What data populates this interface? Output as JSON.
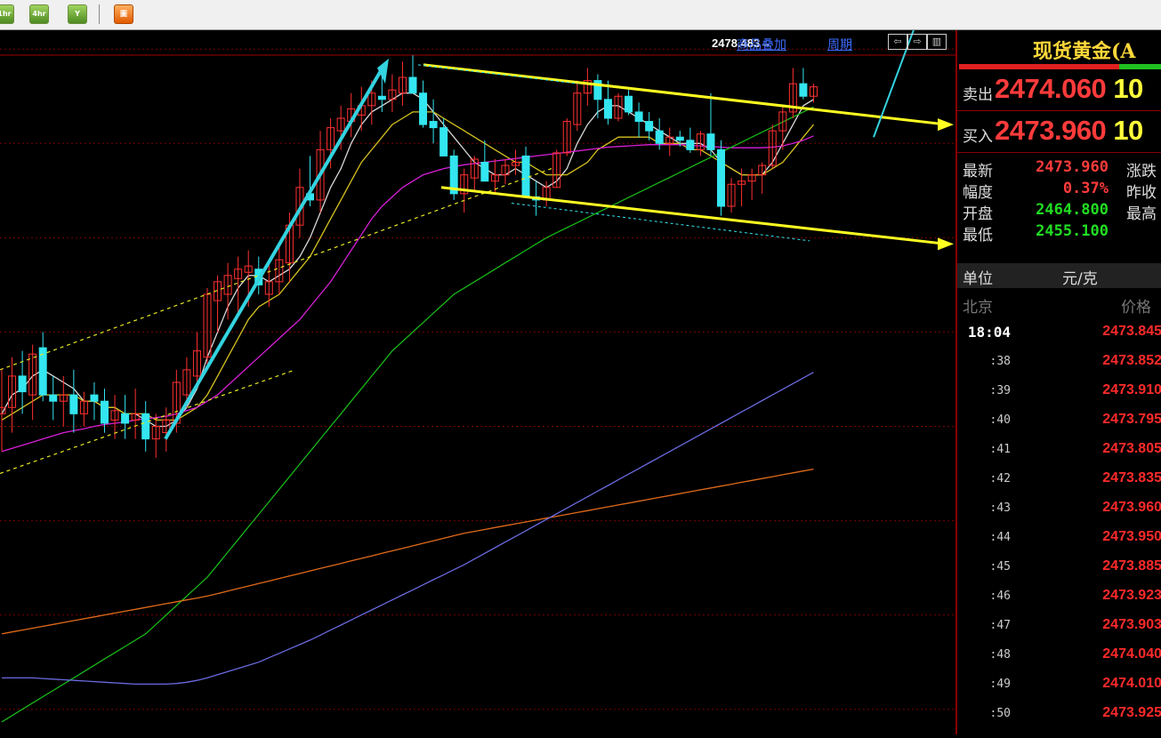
{
  "toolbar": {
    "buttons": [
      {
        "label": "1hr",
        "icon": "hour-chart-icon"
      },
      {
        "label": "4hr",
        "icon": "four-hour-chart-icon"
      },
      {
        "label": "Y",
        "icon": "year-chart-icon"
      },
      {
        "label": "圖",
        "icon": "grid-window-icon"
      }
    ]
  },
  "chart_header": {
    "overlay_label": "商品叠加",
    "period_label": "周期"
  },
  "chart_data": {
    "type": "candlestick",
    "title": "",
    "price_annotation": "2478.483→",
    "ylim": [
      2380,
      2492
    ],
    "candles": [
      [
        2431.0,
        2438.0,
        2425.0,
        2432.0
      ],
      [
        2432.0,
        2440.0,
        2428.0,
        2437.0
      ],
      [
        2437.0,
        2441.0,
        2431.0,
        2434.5
      ],
      [
        2434.0,
        2442.0,
        2430.0,
        2440.5
      ],
      [
        2441.5,
        2444.0,
        2433.0,
        2434.0
      ],
      [
        2434.0,
        2437.0,
        2430.0,
        2433.0
      ],
      [
        2433.0,
        2437.0,
        2429.0,
        2434.0
      ],
      [
        2434.0,
        2438.0,
        2428.0,
        2431.0
      ],
      [
        2431.0,
        2434.5,
        2429.0,
        2433.0
      ],
      [
        2434.0,
        2436.0,
        2430.0,
        2433.0
      ],
      [
        2433.0,
        2435.0,
        2428.0,
        2429.5
      ],
      [
        2430.0,
        2434.0,
        2427.0,
        2431.5
      ],
      [
        2431.0,
        2434.0,
        2427.0,
        2429.5
      ],
      [
        2430.0,
        2435.0,
        2427.0,
        2431.0
      ],
      [
        2431.0,
        2433.0,
        2425.0,
        2427.0
      ],
      [
        2427.0,
        2431.0,
        2424.0,
        2429.0
      ],
      [
        2428.0,
        2432.0,
        2425.0,
        2430.0
      ],
      [
        2429.5,
        2438.0,
        2428.0,
        2436.0
      ],
      [
        2434.0,
        2440.0,
        2432.0,
        2438.0
      ],
      [
        2437.0,
        2444.0,
        2435.0,
        2441.0
      ],
      [
        2440.0,
        2451.0,
        2438.0,
        2450.0
      ],
      [
        2449.0,
        2453.0,
        2444.0,
        2452.0
      ],
      [
        2450.0,
        2455.0,
        2446.0,
        2453.0
      ],
      [
        2452.5,
        2456.0,
        2447.0,
        2454.0
      ],
      [
        2453.5,
        2457.0,
        2448.0,
        2454.5
      ],
      [
        2454.0,
        2456.0,
        2450.0,
        2451.5
      ],
      [
        2450.0,
        2455.0,
        2448.0,
        2452.0
      ],
      [
        2452.0,
        2458.0,
        2450.0,
        2455.5
      ],
      [
        2455.0,
        2463.0,
        2452.0,
        2461.0
      ],
      [
        2461.0,
        2470.0,
        2459.0,
        2467.0
      ],
      [
        2466.0,
        2472.0,
        2464.0,
        2465.0
      ],
      [
        2465.0,
        2476.0,
        2463.0,
        2473.0
      ],
      [
        2473.0,
        2478.0,
        2470.0,
        2476.5
      ],
      [
        2476.0,
        2480.0,
        2473.0,
        2478.0
      ],
      [
        2477.5,
        2482.0,
        2475.0,
        2479.5
      ],
      [
        2478.5,
        2483.0,
        2476.0,
        2480.0
      ],
      [
        2480.0,
        2484.0,
        2477.0,
        2482.0
      ],
      [
        2481.5,
        2485.0,
        2479.0,
        2481.0
      ],
      [
        2481.0,
        2485.0,
        2479.0,
        2482.5
      ],
      [
        2482.0,
        2487.0,
        2480.0,
        2484.5
      ],
      [
        2484.5,
        2488.0,
        2482.0,
        2482.0
      ],
      [
        2482.0,
        2484.0,
        2476.5,
        2477.0
      ],
      [
        2477.5,
        2481.0,
        2474.0,
        2476.5
      ],
      [
        2476.5,
        2478.0,
        2472.5,
        2472.0
      ],
      [
        2472.0,
        2473.0,
        2465.0,
        2466.0
      ],
      [
        2466.0,
        2470.0,
        2463.0,
        2469.0
      ],
      [
        2468.5,
        2472.0,
        2466.5,
        2471.5
      ],
      [
        2471.0,
        2474.5,
        2469.5,
        2468.0
      ],
      [
        2468.0,
        2471.5,
        2466.0,
        2469.0
      ],
      [
        2469.0,
        2471.5,
        2467.5,
        2470.5
      ],
      [
        2470.5,
        2473.0,
        2469.0,
        2471.0
      ],
      [
        2472.0,
        2473.5,
        2466.5,
        2465.5
      ],
      [
        2465.5,
        2468.0,
        2462.5,
        2465.0
      ],
      [
        2465.0,
        2468.0,
        2464.0,
        2467.0
      ],
      [
        2467.0,
        2473.0,
        2467.0,
        2472.5
      ],
      [
        2472.5,
        2478.0,
        2472.0,
        2477.5
      ],
      [
        2477.0,
        2484.0,
        2476.0,
        2482.0
      ],
      [
        2482.0,
        2486.0,
        2480.0,
        2484.0
      ],
      [
        2484.0,
        2485.0,
        2478.0,
        2481.0
      ],
      [
        2481.0,
        2484.0,
        2477.0,
        2478.0
      ],
      [
        2478.0,
        2482.0,
        2477.5,
        2481.5
      ],
      [
        2481.5,
        2482.5,
        2478.5,
        2479.0
      ],
      [
        2479.0,
        2480.5,
        2475.0,
        2477.5
      ],
      [
        2477.5,
        2479.0,
        2474.5,
        2476.0
      ],
      [
        2476.0,
        2478.0,
        2473.0,
        2474.0
      ],
      [
        2474.0,
        2476.5,
        2472.0,
        2475.0
      ],
      [
        2475.0,
        2476.0,
        2473.5,
        2474.5
      ],
      [
        2474.5,
        2476.5,
        2472.5,
        2473.0
      ],
      [
        2473.0,
        2476.0,
        2472.0,
        2475.5
      ],
      [
        2475.5,
        2482.0,
        2472.0,
        2473.0
      ],
      [
        2473.0,
        2474.5,
        2462.5,
        2464.0
      ],
      [
        2464.0,
        2468.5,
        2463.0,
        2467.5
      ],
      [
        2467.5,
        2470.0,
        2464.0,
        2468.0
      ],
      [
        2468.0,
        2470.0,
        2465.0,
        2469.0
      ],
      [
        2469.0,
        2471.0,
        2466.0,
        2470.5
      ],
      [
        2470.5,
        2477.0,
        2470.0,
        2476.0
      ],
      [
        2476.0,
        2480.0,
        2473.0,
        2479.0
      ],
      [
        2479.0,
        2486.0,
        2478.0,
        2483.5
      ],
      [
        2483.5,
        2486.0,
        2481.0,
        2481.5
      ],
      [
        2481.5,
        2483.5,
        2480.5,
        2483.0
      ]
    ],
    "moving_averages": [
      {
        "color": "#d9d9d9",
        "values": [
          2431,
          2434,
          2435,
          2437,
          2438,
          2437,
          2436,
          2435,
          2433,
          2433,
          2432,
          2432,
          2431,
          2431,
          2430,
          2429,
          2429,
          2430,
          2432,
          2435,
          2440,
          2444,
          2448,
          2451,
          2453,
          2453,
          2452,
          2453,
          2454,
          2456,
          2459,
          2463,
          2467,
          2470,
          2474,
          2477,
          2479,
          2480,
          2481,
          2482,
          2482,
          2481,
          2479,
          2477,
          2475,
          2473,
          2471,
          2470,
          2469,
          2469,
          2470,
          2469,
          2468,
          2467,
          2468,
          2470,
          2474,
          2477,
          2479,
          2480,
          2480,
          2479,
          2478,
          2477,
          2476,
          2475,
          2474,
          2474,
          2474,
          2473,
          2471,
          2470,
          2469,
          2469,
          2469,
          2471,
          2474,
          2477,
          2480,
          2481
        ]
      },
      {
        "color": "#d6c21f",
        "values": [
          2430,
          2431,
          2432,
          2433,
          2434,
          2434,
          2434,
          2434,
          2433,
          2433,
          2432,
          2432,
          2431,
          2431,
          2431,
          2430,
          2430,
          2430,
          2431,
          2432,
          2434,
          2437,
          2440,
          2443,
          2446,
          2448,
          2449,
          2450,
          2452,
          2454,
          2456,
          2459,
          2462,
          2465,
          2468,
          2471,
          2473,
          2475,
          2477,
          2478,
          2479,
          2479,
          2479,
          2478,
          2477,
          2476,
          2475,
          2474,
          2473,
          2472,
          2471,
          2471,
          2470,
          2469,
          2469,
          2469,
          2470,
          2471,
          2473,
          2474,
          2475,
          2475,
          2475,
          2475,
          2474,
          2474,
          2474,
          2473,
          2473,
          2472,
          2471,
          2470,
          2469,
          2469,
          2469,
          2470,
          2471,
          2473,
          2475,
          2477
        ]
      },
      {
        "color": "#d81fd8",
        "values": [
          2425,
          2425.5,
          2426,
          2426.5,
          2427,
          2427.5,
          2428,
          2428.3,
          2428.6,
          2429,
          2429.3,
          2429.5,
          2429.7,
          2430,
          2430.2,
          2430.4,
          2430.6,
          2431,
          2431.5,
          2432,
          2433,
          2434,
          2435.5,
          2437,
          2438.5,
          2440,
          2441.5,
          2443,
          2444.5,
          2446,
          2448,
          2450,
          2452,
          2454.5,
          2457,
          2459.5,
          2462,
          2464,
          2465.5,
          2467,
          2468,
          2469,
          2469.5,
          2470,
          2470.3,
          2470.6,
          2470.8,
          2471,
          2471.2,
          2471.4,
          2471.6,
          2471.8,
          2472,
          2472.2,
          2472.4,
          2472.6,
          2472.8,
          2473,
          2473.2,
          2473.4,
          2473.5,
          2473.6,
          2473.7,
          2473.8,
          2473.8,
          2473.8,
          2473.8,
          2473.7,
          2473.6,
          2473.5,
          2473.4,
          2473.3,
          2473.3,
          2473.3,
          2473.3,
          2473.4,
          2473.6,
          2474,
          2474.5,
          2475.2
        ]
      },
      {
        "color": "#18b818",
        "values": [
          2382,
          2383,
          2384,
          2385,
          2386,
          2387,
          2388,
          2389,
          2390,
          2391,
          2392,
          2393,
          2394,
          2395,
          2396,
          2397.5,
          2399,
          2400.5,
          2402,
          2403.5,
          2405,
          2407,
          2409,
          2411,
          2413,
          2415,
          2417,
          2419,
          2421,
          2423,
          2425,
          2427,
          2429,
          2431,
          2433,
          2435,
          2437,
          2439,
          2441,
          2442.5,
          2444,
          2445.5,
          2447,
          2448.5,
          2450,
          2451,
          2452,
          2453,
          2454,
          2455,
          2456,
          2457,
          2458,
          2459,
          2459.8,
          2460.6,
          2461.4,
          2462.2,
          2463,
          2463.8,
          2464.6,
          2465.4,
          2466.2,
          2467,
          2467.8,
          2468.6,
          2469.4,
          2470.2,
          2471,
          2471.8,
          2472.6,
          2473.4,
          2474.2,
          2475,
          2475.8,
          2476.6,
          2477.4,
          2478.2,
          2479,
          2479.8
        ]
      },
      {
        "color": "#e06a1a",
        "values": [
          2396,
          2396.3,
          2396.6,
          2396.9,
          2397.2,
          2397.5,
          2397.8,
          2398.1,
          2398.4,
          2398.7,
          2399,
          2399.3,
          2399.6,
          2399.9,
          2400.2,
          2400.5,
          2400.8,
          2401.1,
          2401.4,
          2401.7,
          2402,
          2402.4,
          2402.8,
          2403.2,
          2403.6,
          2404,
          2404.4,
          2404.8,
          2405.2,
          2405.6,
          2406,
          2406.4,
          2406.8,
          2407.2,
          2407.6,
          2408,
          2408.4,
          2408.8,
          2409.2,
          2409.6,
          2410,
          2410.4,
          2410.8,
          2411.2,
          2411.6,
          2412,
          2412.3,
          2412.6,
          2412.9,
          2413.2,
          2413.5,
          2413.8,
          2414.1,
          2414.4,
          2414.7,
          2415,
          2415.3,
          2415.6,
          2415.9,
          2416.2,
          2416.5,
          2416.8,
          2417.1,
          2417.4,
          2417.7,
          2418,
          2418.3,
          2418.6,
          2418.9,
          2419.2,
          2419.5,
          2419.8,
          2420.1,
          2420.4,
          2420.7,
          2421,
          2421.3,
          2421.6,
          2421.9,
          2422.2
        ]
      },
      {
        "color": "#6a6ae0",
        "values": [
          2389,
          2389,
          2389,
          2389,
          2388.9,
          2388.8,
          2388.7,
          2388.6,
          2388.5,
          2388.4,
          2388.3,
          2388.2,
          2388.1,
          2388,
          2388,
          2388,
          2388,
          2388.1,
          2388.3,
          2388.6,
          2389,
          2389.5,
          2390,
          2390.5,
          2391,
          2391.5,
          2392.2,
          2392.9,
          2393.6,
          2394.3,
          2395,
          2395.8,
          2396.6,
          2397.4,
          2398.2,
          2399,
          2399.8,
          2400.6,
          2401.4,
          2402.2,
          2403,
          2403.8,
          2404.6,
          2405.4,
          2406.2,
          2407,
          2407.9,
          2408.8,
          2409.7,
          2410.6,
          2411.5,
          2412.4,
          2413.3,
          2414.2,
          2415.1,
          2416,
          2416.9,
          2417.8,
          2418.7,
          2419.6,
          2420.5,
          2421.4,
          2422.3,
          2423.2,
          2424.1,
          2425,
          2425.9,
          2426.8,
          2427.7,
          2428.6,
          2429.5,
          2430.4,
          2431.3,
          2432.2,
          2433.1,
          2434,
          2434.9,
          2435.8,
          2436.7,
          2437.6
        ]
      }
    ],
    "gridlines": [
      2489,
      2474,
      2459,
      2444,
      2429,
      2414,
      2399,
      2384
    ]
  },
  "quote_panel": {
    "title": "现货黄金(A",
    "sell_label": "卖出",
    "sell_price": "2474.060",
    "sell_qty": "10",
    "buy_label": "买入",
    "buy_price": "2473.960",
    "buy_qty": "10",
    "stats": [
      {
        "label": "最新",
        "value": "2473.960",
        "color": "#ff3b3b",
        "label2": "涨跌"
      },
      {
        "label": "幅度",
        "value": "0.37%",
        "color": "#ff3b3b",
        "label2": "昨收"
      },
      {
        "label": "开盘",
        "value": "2464.800",
        "color": "#22dd22",
        "label2": "最高"
      },
      {
        "label": "最低",
        "value": "2455.100",
        "color": "#22dd22",
        "label2": ""
      }
    ],
    "unit_label": "单位",
    "unit_value": "元/克",
    "col_time": "北京",
    "col_price": "价格",
    "ticks": [
      {
        "time": "18:04",
        "price": "2473.845"
      },
      {
        "time": ":38",
        "price": "2473.852"
      },
      {
        "time": ":39",
        "price": "2473.910"
      },
      {
        "time": ":40",
        "price": "2473.795"
      },
      {
        "time": ":41",
        "price": "2473.805"
      },
      {
        "time": ":42",
        "price": "2473.835"
      },
      {
        "time": ":43",
        "price": "2473.960"
      },
      {
        "time": ":44",
        "price": "2473.950"
      },
      {
        "time": ":45",
        "price": "2473.885"
      },
      {
        "time": ":46",
        "price": "2473.923"
      },
      {
        "time": ":47",
        "price": "2473.903"
      },
      {
        "time": ":48",
        "price": "2474.040"
      },
      {
        "time": ":49",
        "price": "2474.010"
      },
      {
        "time": ":50",
        "price": "2473.925"
      }
    ]
  }
}
